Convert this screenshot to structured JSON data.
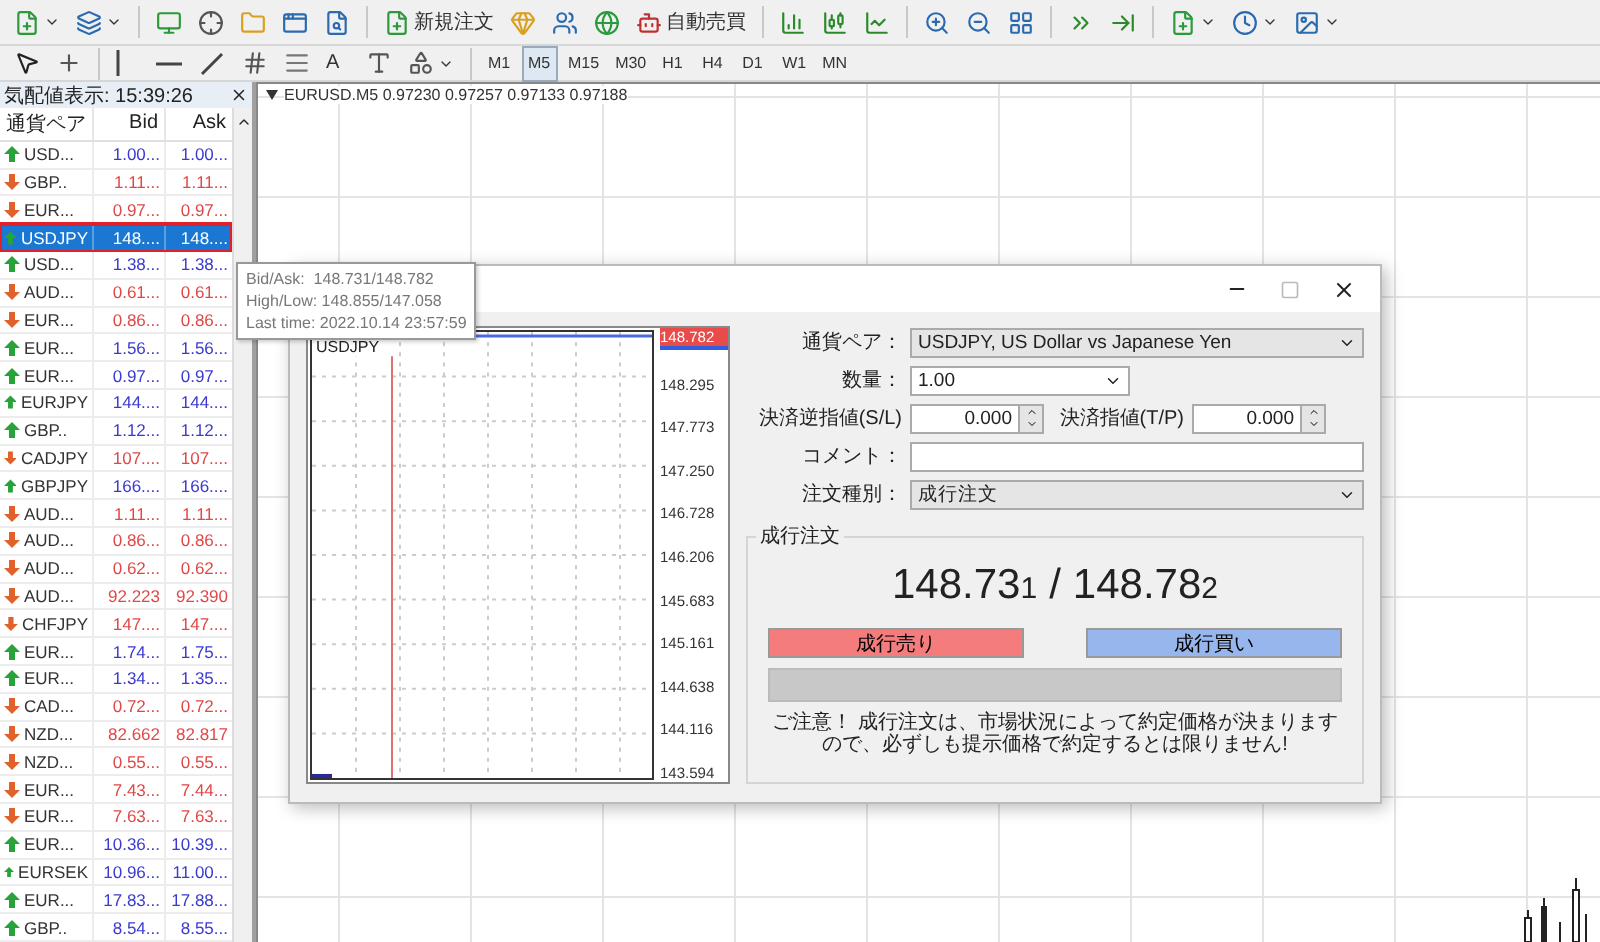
{
  "toolbar_main": {
    "new_order": "新規注文",
    "auto_trading": "自動売買"
  },
  "toolbar_drawing": {
    "text_tool": "A",
    "timeframes": [
      {
        "label": "M1",
        "selected": false
      },
      {
        "label": "M5",
        "selected": true
      },
      {
        "label": "M15",
        "selected": false
      },
      {
        "label": "M30",
        "selected": false
      },
      {
        "label": "H1",
        "selected": false
      },
      {
        "label": "H4",
        "selected": false
      },
      {
        "label": "D1",
        "selected": false
      },
      {
        "label": "W1",
        "selected": false
      },
      {
        "label": "MN",
        "selected": false
      }
    ]
  },
  "market_watch": {
    "title": "気配値表示: 15:39:26",
    "columns": [
      "通貨ペア",
      "Bid",
      "Ask"
    ],
    "rows": [
      {
        "symbol": "USD...",
        "bid": "1.00...",
        "ask": "1.00...",
        "kind": "up",
        "selected": false
      },
      {
        "symbol": "GBP..",
        "bid": "1.11...",
        "ask": "1.11...",
        "kind": "down",
        "selected": false
      },
      {
        "symbol": "EUR...",
        "bid": "0.97...",
        "ask": "0.97...",
        "kind": "down",
        "selected": false
      },
      {
        "symbol": "USDJPY",
        "bid": "148....",
        "ask": "148....",
        "kind": "up",
        "selected": true
      },
      {
        "symbol": "USD...",
        "bid": "1.38...",
        "ask": "1.38...",
        "kind": "up",
        "selected": false
      },
      {
        "symbol": "AUD...",
        "bid": "0.61...",
        "ask": "0.61...",
        "kind": "down",
        "selected": false
      },
      {
        "symbol": "EUR...",
        "bid": "0.86...",
        "ask": "0.86...",
        "kind": "down",
        "selected": false
      },
      {
        "symbol": "EUR...",
        "bid": "1.56...",
        "ask": "1.56...",
        "kind": "up",
        "selected": false
      },
      {
        "symbol": "EUR...",
        "bid": "0.97...",
        "ask": "0.97...",
        "kind": "up",
        "selected": false
      },
      {
        "symbol": "EURJPY",
        "bid": "144....",
        "ask": "144....",
        "kind": "up",
        "selected": false
      },
      {
        "symbol": "GBP..",
        "bid": "1.12...",
        "ask": "1.12...",
        "kind": "up",
        "selected": false
      },
      {
        "symbol": "CADJPY",
        "bid": "107....",
        "ask": "107....",
        "kind": "down",
        "selected": false
      },
      {
        "symbol": "GBPJPY",
        "bid": "166....",
        "ask": "166....",
        "kind": "up",
        "selected": false
      },
      {
        "symbol": "AUD...",
        "bid": "1.11...",
        "ask": "1.11...",
        "kind": "down",
        "selected": false
      },
      {
        "symbol": "AUD...",
        "bid": "0.86...",
        "ask": "0.86...",
        "kind": "down",
        "selected": false
      },
      {
        "symbol": "AUD...",
        "bid": "0.62...",
        "ask": "0.62...",
        "kind": "down",
        "selected": false
      },
      {
        "symbol": "AUD...",
        "bid": "92.223",
        "ask": "92.390",
        "kind": "down",
        "selected": false
      },
      {
        "symbol": "CHFJPY",
        "bid": "147....",
        "ask": "147....",
        "kind": "down",
        "selected": false
      },
      {
        "symbol": "EUR...",
        "bid": "1.74...",
        "ask": "1.75...",
        "kind": "up",
        "selected": false
      },
      {
        "symbol": "EUR...",
        "bid": "1.34...",
        "ask": "1.35...",
        "kind": "up",
        "selected": false
      },
      {
        "symbol": "CAD...",
        "bid": "0.72...",
        "ask": "0.72...",
        "kind": "down",
        "selected": false
      },
      {
        "symbol": "NZD...",
        "bid": "82.662",
        "ask": "82.817",
        "kind": "down",
        "selected": false
      },
      {
        "symbol": "NZD...",
        "bid": "0.55...",
        "ask": "0.55...",
        "kind": "down",
        "selected": false
      },
      {
        "symbol": "EUR...",
        "bid": "7.43...",
        "ask": "7.44...",
        "kind": "down",
        "selected": false
      },
      {
        "symbol": "EUR...",
        "bid": "7.63...",
        "ask": "7.63...",
        "kind": "down",
        "selected": false
      },
      {
        "symbol": "EUR...",
        "bid": "10.36...",
        "ask": "10.39...",
        "kind": "up",
        "selected": false
      },
      {
        "symbol": "EURSEK",
        "bid": "10.96...",
        "ask": "11.00...",
        "kind": "up",
        "selected": false
      },
      {
        "symbol": "EUR...",
        "bid": "17.83...",
        "ask": "17.88...",
        "kind": "up",
        "selected": false
      },
      {
        "symbol": "GBP..",
        "bid": "8.54...",
        "ask": "8.55...",
        "kind": "up",
        "selected": false
      }
    ]
  },
  "tooltip": {
    "lines": [
      "Bid/Ask:  148.731/148.782",
      "High/Low: 148.855/147.058",
      "Last time: 2022.10.14 23:57:59"
    ]
  },
  "chart": {
    "header": "EURUSD.M5 0.97230 0.97257 0.97133 0.97188"
  },
  "order_dialog": {
    "mini_chart": {
      "symbol": "USDJPY",
      "current_price": "148.782",
      "price_labels": [
        "148.295",
        "147.773",
        "147.250",
        "146.728",
        "146.206",
        "145.683",
        "145.161",
        "144.638",
        "144.116",
        "143.594"
      ]
    },
    "symbol_label": "通貨ペア：",
    "symbol_value": "USDJPY, US Dollar vs Japanese Yen",
    "volume_label": "数量：",
    "volume_value": "1.00",
    "sl_label": "決済逆指値(S/L)",
    "sl_value": "0.000",
    "tp_label": "決済指値(T/P)",
    "tp_value": "0.000",
    "comment_label": "コメント：",
    "type_label": "注文種別：",
    "type_value": "成行注文",
    "group_title": "成行注文",
    "bid_main": "148.73",
    "bid_pip": "1",
    "separator": "/",
    "ask_main": "148.78",
    "ask_pip": "2",
    "sell_button": "成行売り",
    "buy_button": "成行買い",
    "note": "ご注意！ 成行注文は、市場状況によって約定価格が決まりますので、必ずしも提示価格で約定するとは限りません!"
  }
}
